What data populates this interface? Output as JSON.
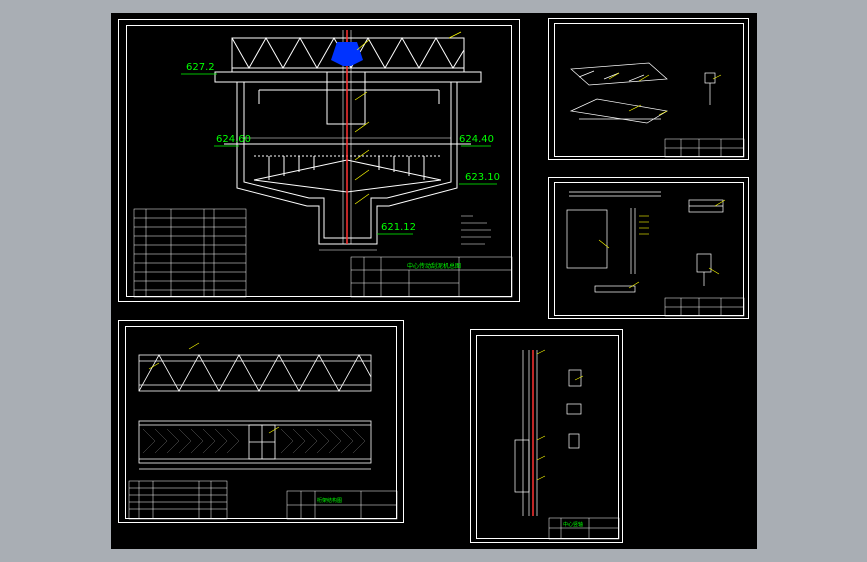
{
  "window": {
    "title": ""
  },
  "colors": {
    "background": "#000000",
    "frame": "#ffffff",
    "dimension": "#00ff00",
    "annotation": "#ffff00",
    "axis": "#ff3333",
    "bracket": "#0033ff"
  },
  "main_sheet": {
    "elevations": {
      "top": "627.2",
      "water_left": "624.60",
      "water_right": "624.40",
      "cone": "623.10",
      "bottom": "621.12"
    },
    "title_block": {
      "title": "中心传动刮泥机总图"
    }
  },
  "truss_sheet": {
    "title_block": {
      "title": "桁架结构图"
    }
  },
  "shaft_sheet": {
    "title_block": {
      "title": "中心竖轴"
    }
  }
}
